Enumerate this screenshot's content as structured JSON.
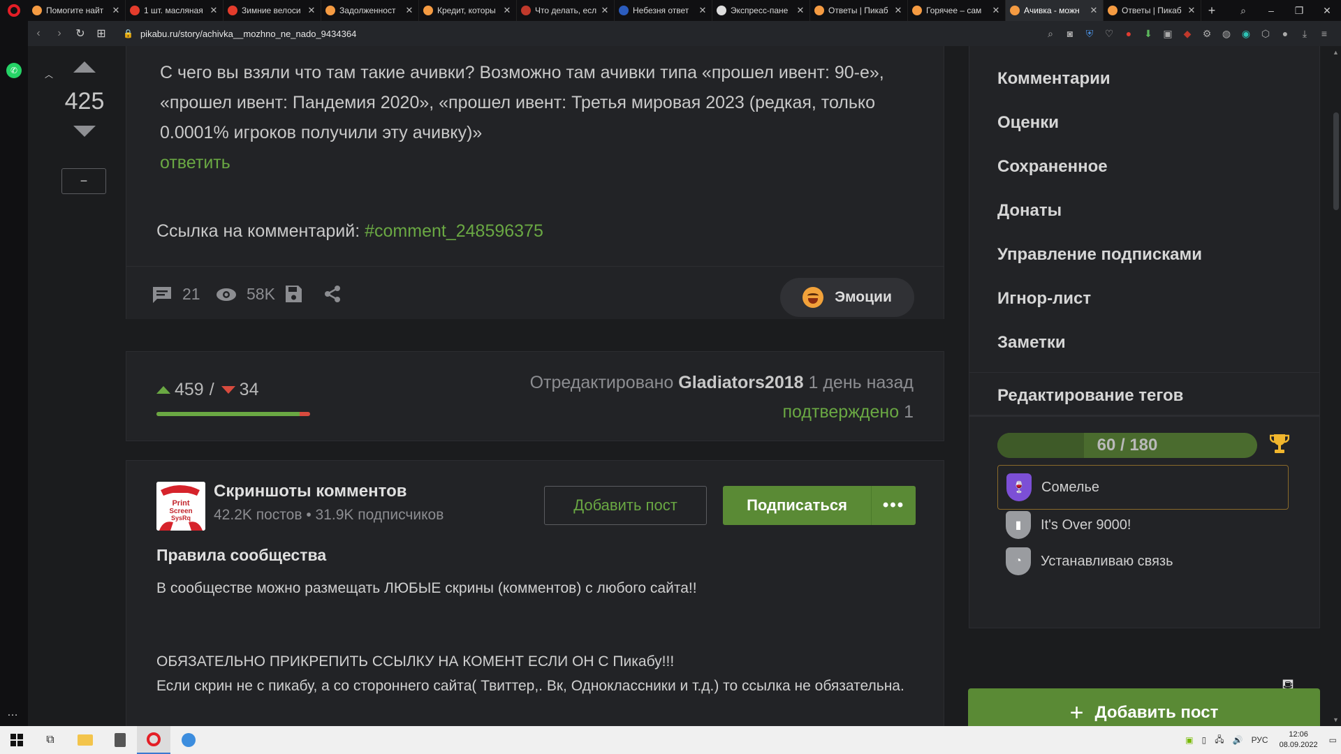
{
  "browser": {
    "tabs": [
      {
        "title": "Помогите найт",
        "color": "#f59b42",
        "active": false
      },
      {
        "title": "1 шт. масляная",
        "color": "#e43c2c",
        "active": false
      },
      {
        "title": "Зимние велоси",
        "color": "#e43c2c",
        "active": false
      },
      {
        "title": "Задолженност",
        "color": "#f59b42",
        "active": false
      },
      {
        "title": "Кредит, которы",
        "color": "#f59b42",
        "active": false
      },
      {
        "title": "Что делать, есл",
        "color": "#c0392b",
        "active": false
      },
      {
        "title": "Небезня ответ",
        "color": "#2b5cbe",
        "active": false
      },
      {
        "title": "Экспресс-пане",
        "color": "#dddddd",
        "active": false
      },
      {
        "title": "Ответы | Пикаб",
        "color": "#f59b42",
        "active": false
      },
      {
        "title": "Горячее – сам",
        "color": "#f59b42",
        "active": false
      },
      {
        "title": "Ачивка - можн",
        "color": "#f59b42",
        "active": true
      },
      {
        "title": "Ответы | Пикаб",
        "color": "#f59b42",
        "active": false
      }
    ],
    "url": "pikabu.ru/story/achivka__mozhno_ne_nado_9434364"
  },
  "post_vote": {
    "score": "425",
    "collapse_label": "−"
  },
  "comment": {
    "text": "С чего вы взяли что там такие ачивки? Возможно там ачивки типа «прошел ивент: 90-е», «прошел ивент: Пандемия 2020», «прошел ивент: Третья мировая 2023 (редкая, только 0.0001% игроков получили эту ачивку)»",
    "reply_label": "ответить",
    "link_prefix": "Ссылка на комментарий:",
    "link_text": "#comment_248596375"
  },
  "post_stats": {
    "comments": "21",
    "views": "58K",
    "emotions_label": "Эмоции"
  },
  "rating": {
    "pluses": "459",
    "separator": "/",
    "minuses": "34",
    "plus_fraction": 0.931,
    "edited_prefix": "Отредактировано",
    "editor": "Gladiators2018",
    "edited_when": "1 день назад",
    "confirmed_label": "подтверждено",
    "confirmed_count": "1"
  },
  "community": {
    "name": "Скриншоты комментов",
    "stats": "42.2K постов • 31.9K подписчиков",
    "avatar_text": [
      "Print",
      "Screen",
      "SysRq"
    ],
    "add_post_label": "Добавить пост",
    "subscribe_label": "Подписаться",
    "more_label": "•••",
    "rules_title": "Правила сообщества",
    "rules": [
      "В сообществе можно размещать ЛЮБЫЕ скрины (комментов) с любого сайта!!",
      "ОБЯЗАТЕЛЬНО ПРИКРЕПИТЬ ССЫЛКУ НА КОМЕНТ ЕСЛИ ОН С Пикабу!!!",
      "Если скрин не с пикабу, а со стороннего сайта( Твиттер,. Вк, Одноклассники и т.д.) то ссылка не обязательна."
    ]
  },
  "sidebar": {
    "menu": [
      "Комментарии",
      "Оценки",
      "Сохраненное",
      "Донаты",
      "Управление подписками",
      "Игнор-лист",
      "Заметки"
    ],
    "tags_edit": "Редактирование тегов",
    "achievements": {
      "progress_text": "60 / 180",
      "progress_fraction": 0.333,
      "items": [
        {
          "label": "Сомелье",
          "color": "#7c4fd6",
          "icon": "wine-glass-icon",
          "selected": true
        },
        {
          "label": "It's Over 9000!",
          "color": "#9a9ca0",
          "icon": "bar-chart-icon",
          "selected": false
        },
        {
          "label": "Устанавливаю связь",
          "color": "#9a9ca0",
          "icon": "rss-icon",
          "selected": false
        }
      ]
    },
    "add_post_label": "Добавить пост"
  },
  "taskbar": {
    "lang": "РУС",
    "time": "12:06",
    "date": "08.09.2022"
  }
}
